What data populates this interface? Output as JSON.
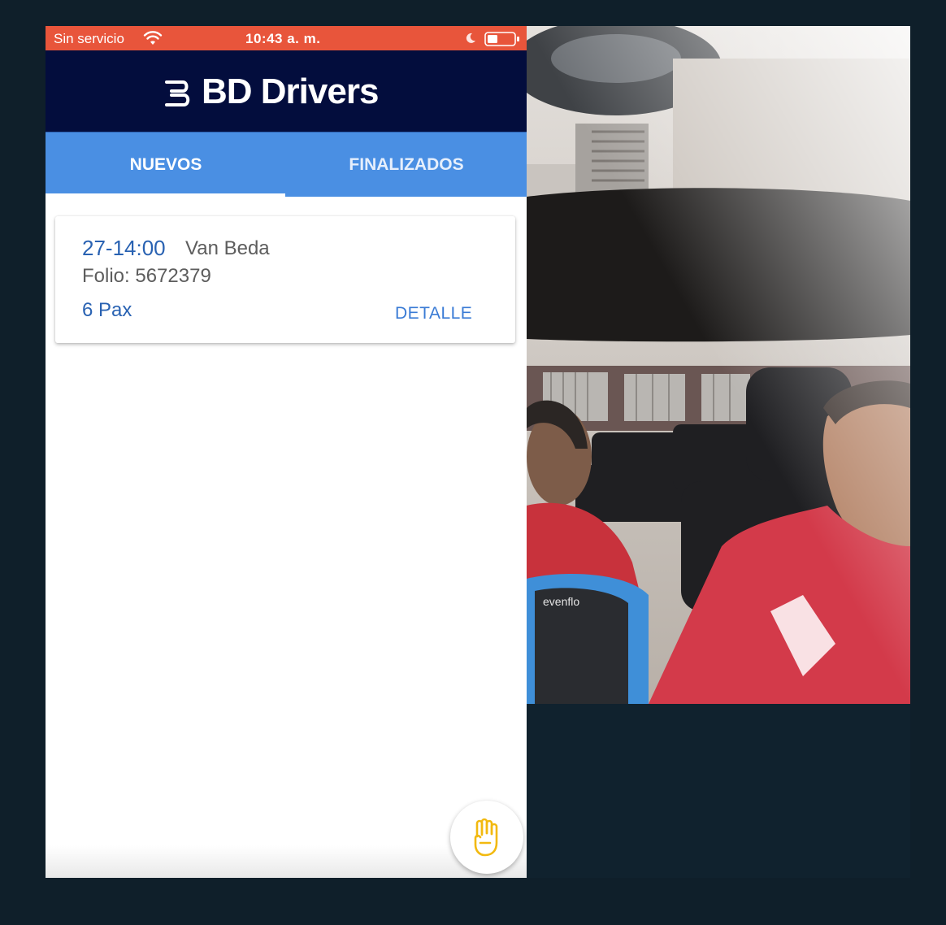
{
  "status_bar": {
    "carrier": "Sin servicio",
    "time": "10:43 a. m.",
    "icons": [
      "wifi-icon",
      "moon-icon",
      "battery-icon"
    ]
  },
  "header": {
    "title": "BD Drivers",
    "logo_icon": "bd-logo-icon"
  },
  "tabs": [
    {
      "label": "NUEVOS",
      "active": true
    },
    {
      "label": "FINALIZADOS",
      "active": false
    }
  ],
  "trip": {
    "time": "27-14:00",
    "vehicle": "Van Beda",
    "folio": "Folio: 5672379",
    "pax": "6 Pax",
    "detail_label": "DETALLE"
  },
  "fab": {
    "icon": "raised-hand-icon"
  },
  "colors": {
    "status_bar": "#e8553b",
    "header": "#030d3d",
    "tabs": "#4a8fe3",
    "accent": "#2962b2",
    "fab_icon": "#f2b90f",
    "background": "#0f1f2a"
  },
  "video_feed": {
    "icon": "camera-feed"
  }
}
